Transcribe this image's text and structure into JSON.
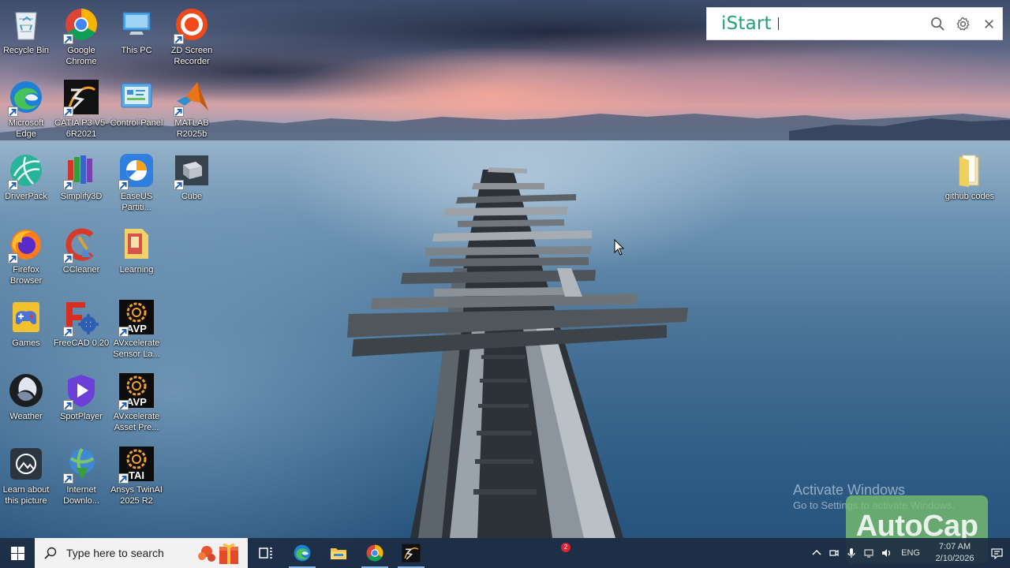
{
  "desktop": {
    "icons": [
      {
        "label": "Recycle Bin",
        "icon": "recycle-bin-icon"
      },
      {
        "label": "Google Chrome",
        "icon": "chrome-icon"
      },
      {
        "label": "This PC",
        "icon": "this-pc-icon"
      },
      {
        "label": "ZD Screen Recorder",
        "icon": "zd-recorder-icon"
      },
      {
        "label": "Microsoft Edge",
        "icon": "edge-icon"
      },
      {
        "label": "CATIA P3 V5-6R2021",
        "icon": "catia-icon"
      },
      {
        "label": "Control Panel",
        "icon": "control-panel-icon"
      },
      {
        "label": "MATLAB R2025b",
        "icon": "matlab-icon"
      },
      {
        "label": "DriverPack",
        "icon": "driverpack-icon"
      },
      {
        "label": "Simplify3D",
        "icon": "simplify3d-icon"
      },
      {
        "label": "EaseUS Partiti...",
        "icon": "easeus-icon"
      },
      {
        "label": "Cube",
        "icon": "cube-icon"
      },
      {
        "label": "Firefox Browser",
        "icon": "firefox-icon"
      },
      {
        "label": "CCleaner",
        "icon": "ccleaner-icon"
      },
      {
        "label": "Learning",
        "icon": "learning-folder-icon"
      },
      {
        "label": "Games",
        "icon": "games-icon"
      },
      {
        "label": "FreeCAD 0.20",
        "icon": "freecad-icon"
      },
      {
        "label": "AVxcelerate Sensor La...",
        "icon": "avp-icon"
      },
      {
        "label": "Weather",
        "icon": "weather-icon"
      },
      {
        "label": "SpotPlayer",
        "icon": "spotplayer-icon"
      },
      {
        "label": "AVxcelerate Asset Pre...",
        "icon": "avp-icon"
      },
      {
        "label": "Learn about this picture",
        "icon": "learn-picture-icon"
      },
      {
        "label": "Internet Downlo...",
        "icon": "internet-download-icon"
      },
      {
        "label": "Ansys TwinAI 2025 R2",
        "icon": "twinai-icon"
      },
      {
        "label": "github codes",
        "icon": "folder-icon"
      }
    ]
  },
  "istart": {
    "brand": "iStart",
    "search_value": "",
    "search_icon": "search-icon",
    "settings_icon": "gear-icon",
    "close_icon": "close-icon"
  },
  "watermark": {
    "activate_title": "Activate Windows",
    "activate_sub": "Go to Settings to activate Windows.",
    "autocap": "AutoCap"
  },
  "taskbar": {
    "search_placeholder": "Type here to search",
    "pinned": [
      "task-view-icon",
      "edge-icon",
      "file-explorer-icon",
      "chrome-icon",
      "catia-icon"
    ],
    "notification_count": "2",
    "language": "ENG",
    "time": "7:07 AM",
    "date": "2/10/2026"
  },
  "colors": {
    "istart_brand": "#23a27a",
    "taskbar_bg": "#1c2c42",
    "autocap_bg": "#78be6e"
  }
}
